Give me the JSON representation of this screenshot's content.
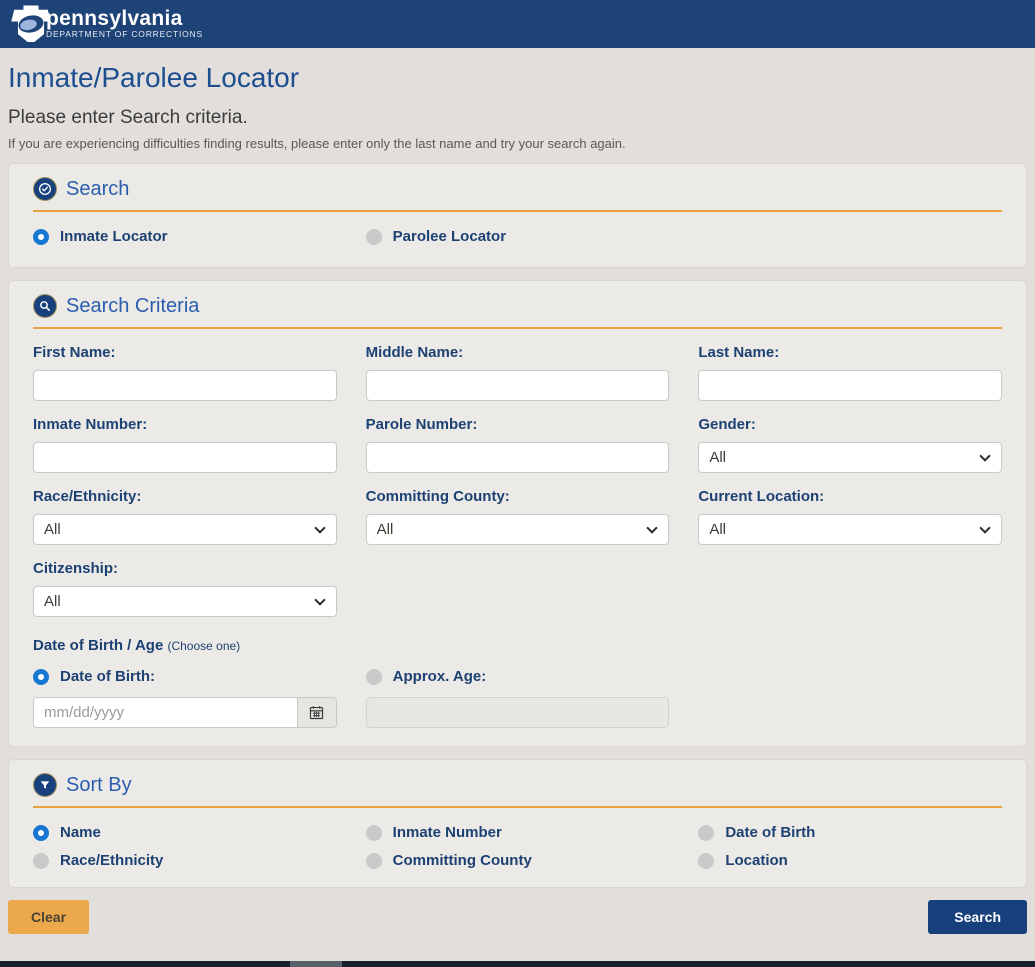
{
  "theme": {
    "header_bg": "#1e4376",
    "accent_orange": "#e9a43f",
    "heading_blue": "#2a5db0",
    "label_navy": "#1d4173",
    "radio_selected_blue": "#1577d1",
    "button_navy": "#17407c",
    "button_orange": "#eba94b"
  },
  "header": {
    "brand": "pennsylvania",
    "brand_sub": "DEPARTMENT OF CORRECTIONS",
    "logo_icon": "keystone-logo"
  },
  "page": {
    "title": "Inmate/Parolee Locator",
    "subtitle": "Please enter Search criteria.",
    "note": "If you are experiencing difficulties finding results, please enter only the last name and try your search again."
  },
  "search_section": {
    "heading": "Search",
    "icon": "check-circle-icon",
    "options": [
      {
        "label": "Inmate Locator",
        "selected": true
      },
      {
        "label": "Parolee Locator",
        "selected": false
      }
    ]
  },
  "criteria": {
    "heading": "Search Criteria",
    "icon": "magnifier-icon",
    "first_name": {
      "label": "First Name:",
      "value": ""
    },
    "middle_name": {
      "label": "Middle Name:",
      "value": ""
    },
    "last_name": {
      "label": "Last Name:",
      "value": ""
    },
    "inmate_number": {
      "label": "Inmate Number:",
      "value": ""
    },
    "parole_number": {
      "label": "Parole Number:",
      "value": ""
    },
    "gender": {
      "label": "Gender:",
      "selected": "All"
    },
    "race": {
      "label": "Race/Ethnicity:",
      "selected": "All"
    },
    "committing_county": {
      "label": "Committing County:",
      "selected": "All"
    },
    "current_location": {
      "label": "Current Location:",
      "selected": "All"
    },
    "citizenship": {
      "label": "Citizenship:",
      "selected": "All"
    },
    "dob_age": {
      "label": "Date of Birth / Age",
      "hint": "(Choose one)",
      "dob": {
        "label": "Date of Birth:",
        "placeholder": "mm/dd/yyyy",
        "value": "",
        "selected": true
      },
      "age": {
        "label": "Approx. Age:",
        "value": "",
        "selected": false,
        "disabled": true
      }
    }
  },
  "sort_section": {
    "heading": "Sort By",
    "icon": "filter-funnel-icon",
    "options": [
      {
        "label": "Name",
        "selected": true
      },
      {
        "label": "Inmate Number",
        "selected": false
      },
      {
        "label": "Date of Birth",
        "selected": false
      },
      {
        "label": "Race/Ethnicity",
        "selected": false
      },
      {
        "label": "Committing County",
        "selected": false
      },
      {
        "label": "Location",
        "selected": false
      }
    ]
  },
  "actions": {
    "clear": "Clear",
    "search": "Search"
  }
}
